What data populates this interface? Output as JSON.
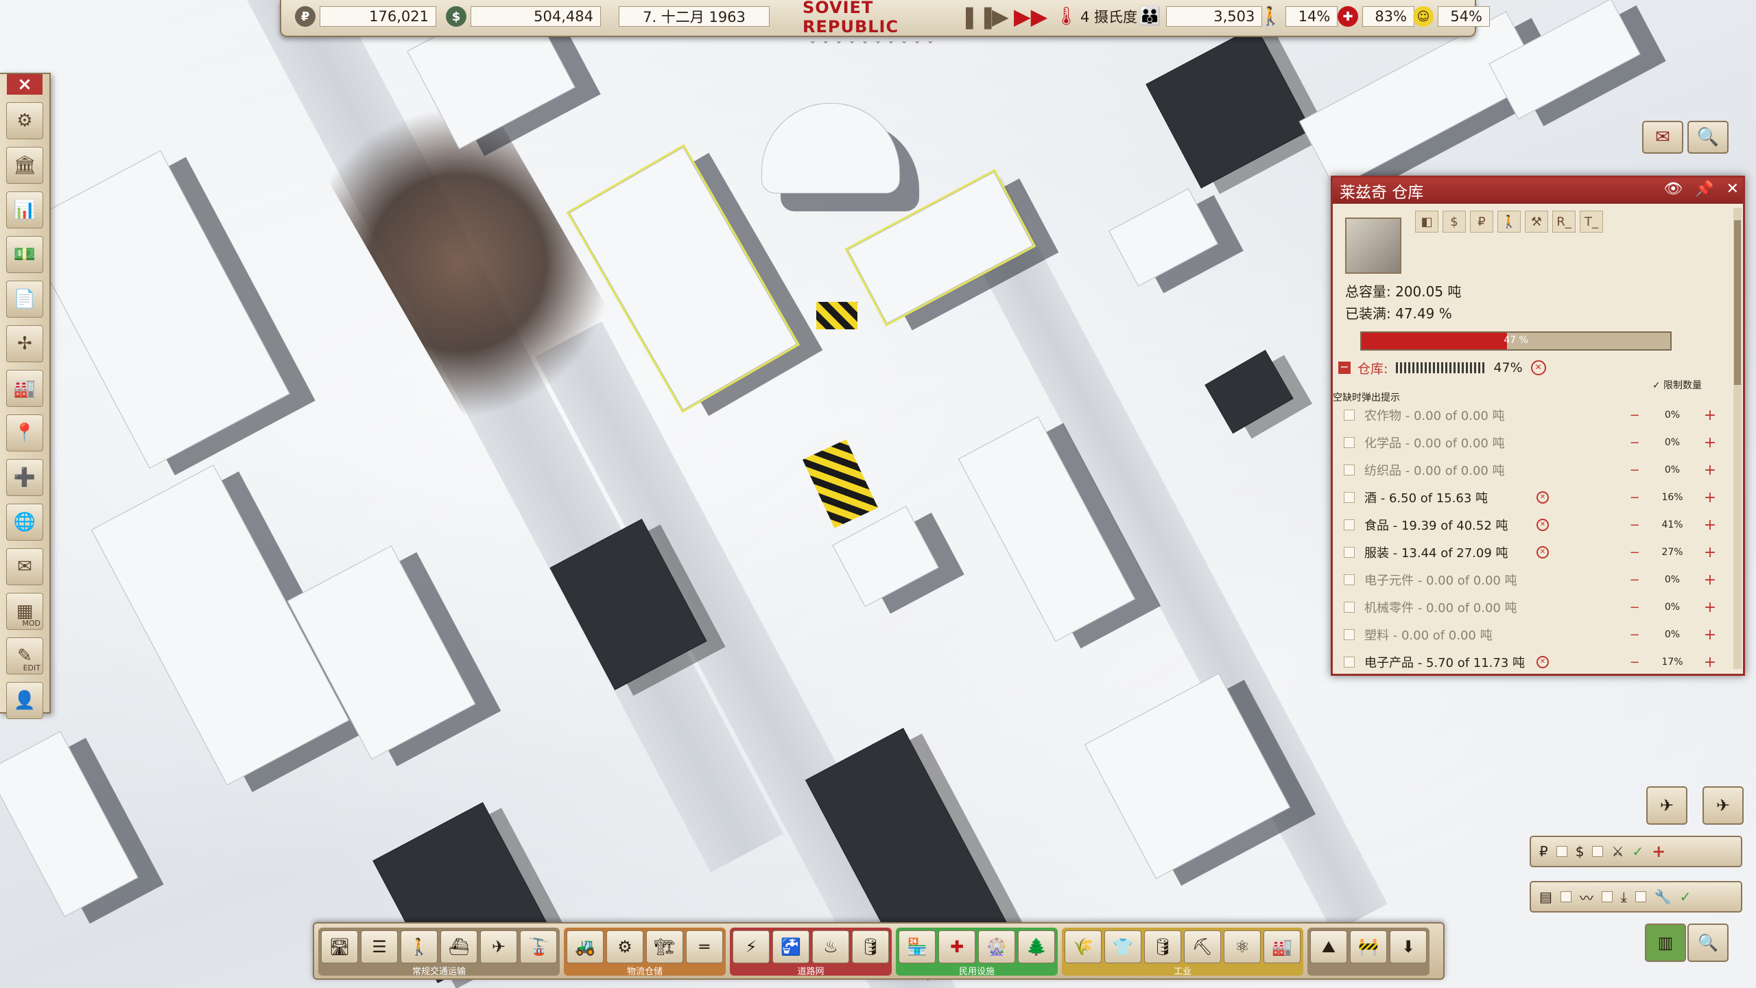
{
  "topbar": {
    "rubles": "176,021",
    "dollars": "504,484",
    "date": "7. 十二月 1963",
    "logo": "SOVIET REPUBLIC",
    "temperature": "4 摄氏度",
    "population": "3,503",
    "unemployment": "14%",
    "health": "83%",
    "happiness": "54%"
  },
  "panel": {
    "title": "莱兹奇 仓库",
    "tab_icons": [
      "R_",
      "T_"
    ],
    "total_capacity": "总容量: 200.05 吨",
    "filled": "已装满: 47.49 %",
    "fill_fraction": 0.47,
    "fill_label": "47 %",
    "warehouse_label": "仓库:",
    "warehouse_pct": "47%",
    "limit_label": "限制数量",
    "empty_hint": "空缺时弹出提示",
    "resources": [
      {
        "name": "农作物 - 0.00 of 0.00 吨",
        "pct": "0%",
        "empty": true
      },
      {
        "name": "化学品 - 0.00 of 0.00 吨",
        "pct": "0%",
        "empty": true
      },
      {
        "name": "纺织品 - 0.00 of 0.00 吨",
        "pct": "0%",
        "empty": true
      },
      {
        "name": "酒 - 6.50 of 15.63 吨",
        "pct": "16%",
        "empty": false
      },
      {
        "name": "食品 - 19.39 of 40.52 吨",
        "pct": "41%",
        "empty": false
      },
      {
        "name": "服装 - 13.44 of 27.09 吨",
        "pct": "27%",
        "empty": false
      },
      {
        "name": "电子元件 - 0.00 of 0.00 吨",
        "pct": "0%",
        "empty": true
      },
      {
        "name": "机械零件 - 0.00 of 0.00 吨",
        "pct": "0%",
        "empty": true
      },
      {
        "name": "塑料 - 0.00 of 0.00 吨",
        "pct": "0%",
        "empty": true
      },
      {
        "name": "电子产品 - 5.70 of 11.73 吨",
        "pct": "17%",
        "empty": false
      }
    ]
  },
  "leftbar": {
    "mod_label": "MOD",
    "edit_label": "EDIT"
  },
  "bottombar": {
    "groups": [
      "常规交通运输",
      "物流仓储",
      "道路网",
      "民用设施",
      "工业"
    ]
  },
  "colors": {
    "accent_red": "#c51f1f",
    "panel_header": "#b23a35",
    "civil_green": "#47a84a"
  }
}
